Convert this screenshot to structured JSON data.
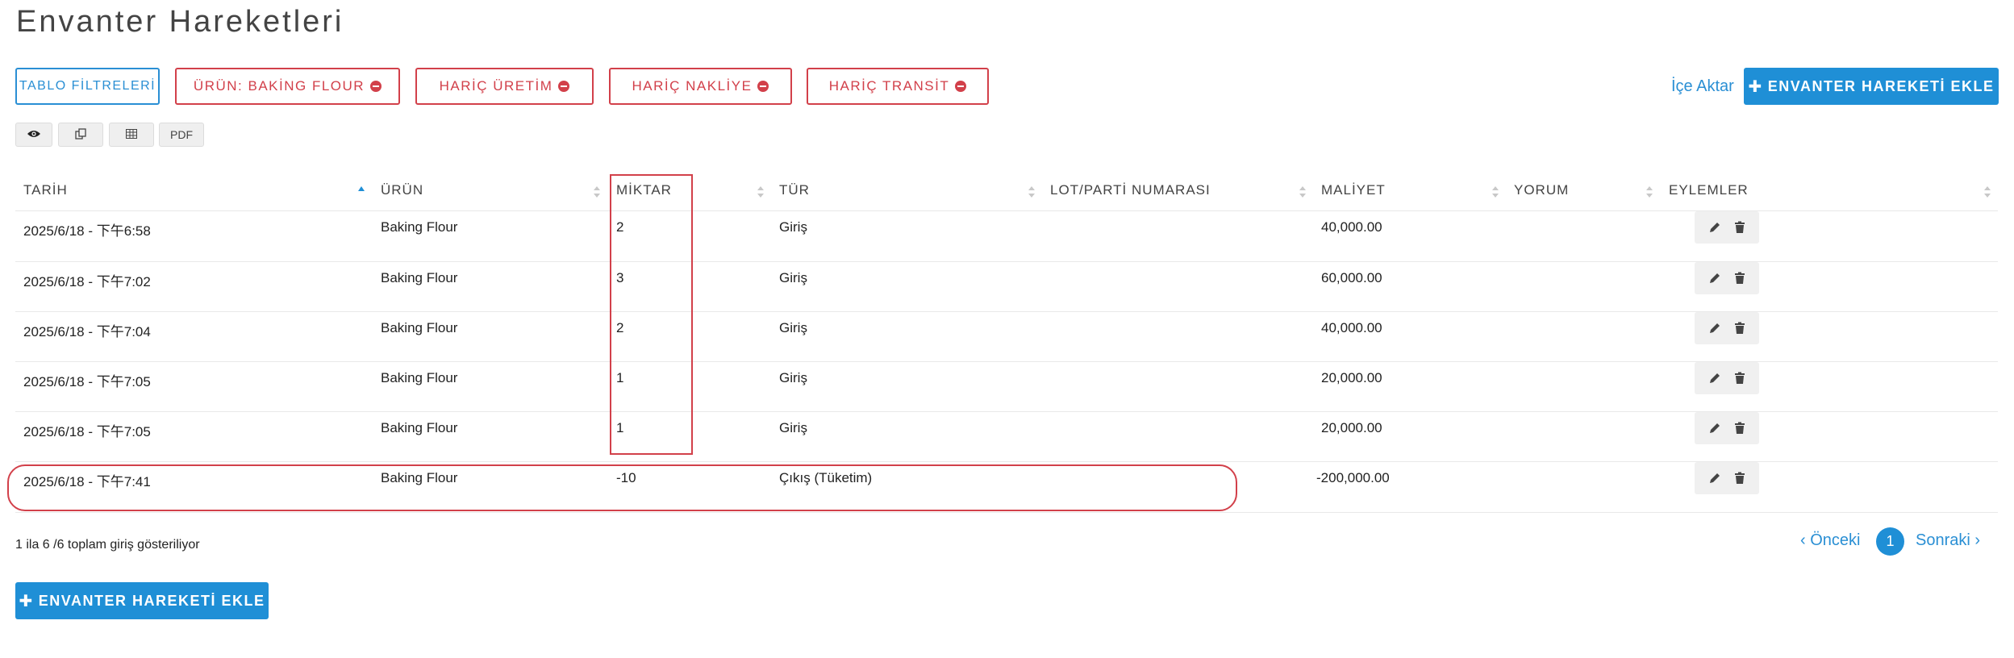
{
  "page": {
    "title": "Envanter Hareketleri"
  },
  "filters": {
    "table_filters_label": "TABLO FİLTRELERİ",
    "chips": [
      {
        "label": "ÜRÜN: BAKİNG FLOUR"
      },
      {
        "label": "HARİÇ ÜRETİM"
      },
      {
        "label": "HARİÇ NAKLİYE"
      },
      {
        "label": "HARİÇ TRANSİT"
      }
    ]
  },
  "header_actions": {
    "import_label": "İçe Aktar",
    "add_label": "ENVANTER HAREKETİ EKLE"
  },
  "toolbar": {
    "pdf_label": "PDF",
    "icons": [
      "eye-icon",
      "copy-icon",
      "table-icon"
    ]
  },
  "table": {
    "columns": [
      "TARİH",
      "ÜRÜN",
      "MİKTAR",
      "TÜR",
      "LOT/PARTİ NUMARASI",
      "MALİYET",
      "YORUM",
      "EYLEMLER"
    ],
    "sorted_column": "TARİH",
    "rows": [
      {
        "date": "2025/6/18 - 下午6:58",
        "product": "Baking Flour",
        "qty": "2",
        "type": "Giriş",
        "lot": "",
        "cost": "40,000.00",
        "comment": ""
      },
      {
        "date": "2025/6/18 - 下午7:02",
        "product": "Baking Flour",
        "qty": "3",
        "type": "Giriş",
        "lot": "",
        "cost": "60,000.00",
        "comment": ""
      },
      {
        "date": "2025/6/18 - 下午7:04",
        "product": "Baking Flour",
        "qty": "2",
        "type": "Giriş",
        "lot": "",
        "cost": "40,000.00",
        "comment": ""
      },
      {
        "date": "2025/6/18 - 下午7:05",
        "product": "Baking Flour",
        "qty": "1",
        "type": "Giriş",
        "lot": "",
        "cost": "20,000.00",
        "comment": ""
      },
      {
        "date": "2025/6/18 - 下午7:05",
        "product": "Baking Flour",
        "qty": "1",
        "type": "Giriş",
        "lot": "",
        "cost": "20,000.00",
        "comment": ""
      },
      {
        "date": "2025/6/18 - 下午7:41",
        "product": "Baking Flour",
        "qty": "-10",
        "type": "Çıkış (Tüketim)",
        "lot": "",
        "cost": "-200,000.00",
        "comment": ""
      }
    ]
  },
  "footer": {
    "showing_text": "1 ila 6 /6 toplam giriş gösteriliyor",
    "prev_label": "‹ Önceki",
    "current_page": "1",
    "next_label": "Sonraki ›",
    "add_label": "ENVANTER HAREKETİ EKLE"
  },
  "colors": {
    "accent": "#1f8fd6",
    "danger": "#d2404a"
  }
}
